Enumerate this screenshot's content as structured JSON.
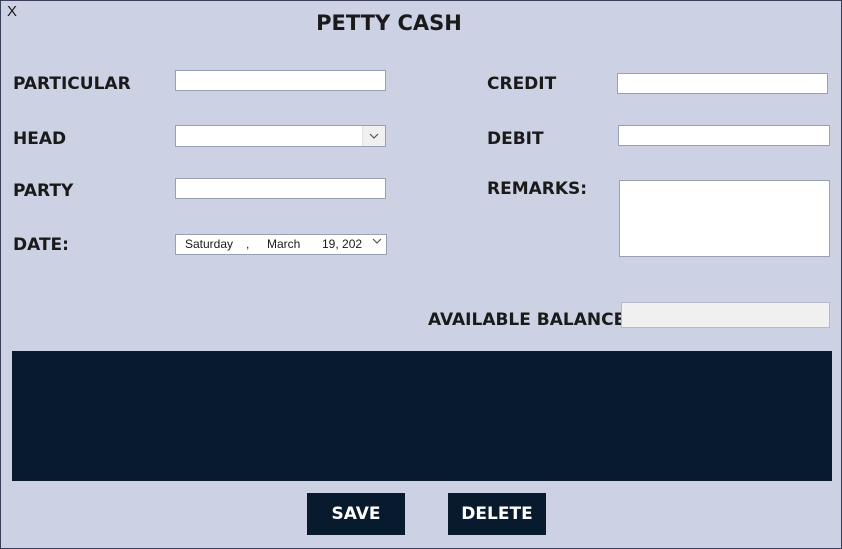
{
  "window": {
    "close_label": "X",
    "title": "PETTY CASH"
  },
  "labels": {
    "particular": "PARTICULAR",
    "head": "HEAD",
    "party": "PARTY",
    "date": "DATE:",
    "credit": "CREDIT",
    "debit": "DEBIT",
    "remarks": "REMARKS:",
    "available_balance": "AVAILABLE BALANCE"
  },
  "fields": {
    "particular": "",
    "head": "",
    "party": "",
    "credit": "",
    "debit": "",
    "remarks": "",
    "available_balance": ""
  },
  "date_picker": {
    "weekday": "Saturday",
    "sep": ",",
    "month": "March",
    "day_year": "19, 202"
  },
  "buttons": {
    "save": "SAVE",
    "delete": "DELETE"
  },
  "colors": {
    "background": "#cdd1e4",
    "grid_and_buttons": "#081a2e"
  },
  "icons": {
    "dropdown": "chevron-down-icon"
  }
}
